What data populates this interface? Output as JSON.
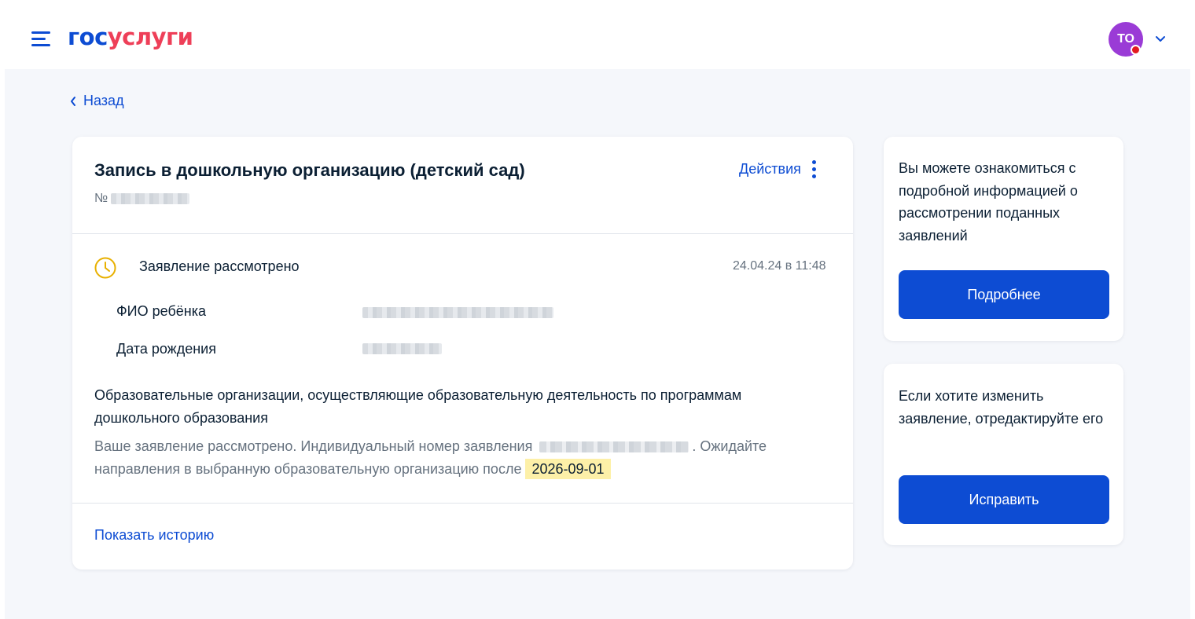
{
  "header": {
    "logo_part1": "гос",
    "logo_part2": "услуги",
    "avatar_initials": "ТО"
  },
  "nav": {
    "back_label": "Назад"
  },
  "application": {
    "title": "Запись в дошкольную организацию (детский сад)",
    "number_prefix": "№",
    "actions_label": "Действия",
    "status_text": "Заявление рассмотрено",
    "status_datetime": "24.04.24 в 11:48",
    "fields": [
      {
        "label": "ФИО ребёнка"
      },
      {
        "label": "Дата рождения"
      }
    ],
    "org_text": "Образовательные организации, осуществляющие образовательную деятельность по программам дошкольного образования",
    "note_part1": "Ваше заявление рассмотрено. Индивидуальный номер заявления",
    "note_part2": ". Ожидайте направления в выбранную образовательную организацию после",
    "note_date": "2026-09-01",
    "history_link": "Показать историю"
  },
  "sidebar": {
    "info_text": "Вы можете ознакомиться с подробной информацией о рассмотрении поданных заявлений",
    "info_button": "Подробнее",
    "edit_text": "Если хотите изменить заявление, отредактируйте его",
    "edit_button": "Исправить"
  },
  "colors": {
    "brand_blue": "#0d4cd3",
    "brand_red": "#ee3f58",
    "highlight": "#fdf0a8",
    "clock_icon": "#e8b000"
  }
}
